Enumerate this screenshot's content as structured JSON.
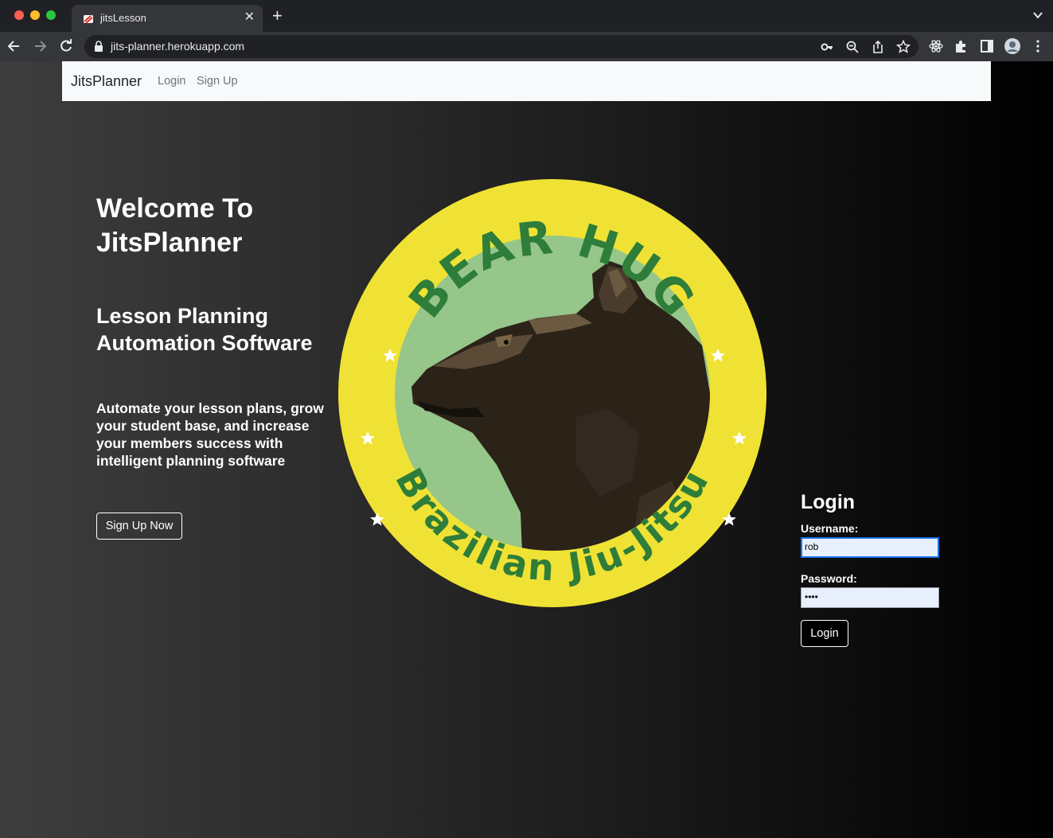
{
  "browser": {
    "tab_title": "jitsLesson",
    "url": "jits-planner.herokuapp.com",
    "new_tab_symbol": "+",
    "close_symbol": "✕"
  },
  "navbar": {
    "brand": "JitsPlanner",
    "links": [
      "Login",
      "Sign Up"
    ]
  },
  "hero": {
    "title": "Welcome To JitsPlanner",
    "subtitle": "Lesson Planning Automation Software",
    "description": "Automate your lesson plans, grow your student base, and increase your members success with intelligent planning software",
    "cta_label": "Sign Up Now"
  },
  "logo": {
    "top_text": "BEAR HUG",
    "bottom_text": "Brazilian Jiu-Jitsu",
    "colors": {
      "ring": "#f0e234",
      "inner": "#96c68a",
      "text": "#2e7d3a",
      "bear": "#2b2218"
    }
  },
  "login": {
    "title": "Login",
    "username_label": "Username:",
    "username_value": "rob",
    "password_label": "Password:",
    "password_value": "••••",
    "button_label": "Login"
  }
}
